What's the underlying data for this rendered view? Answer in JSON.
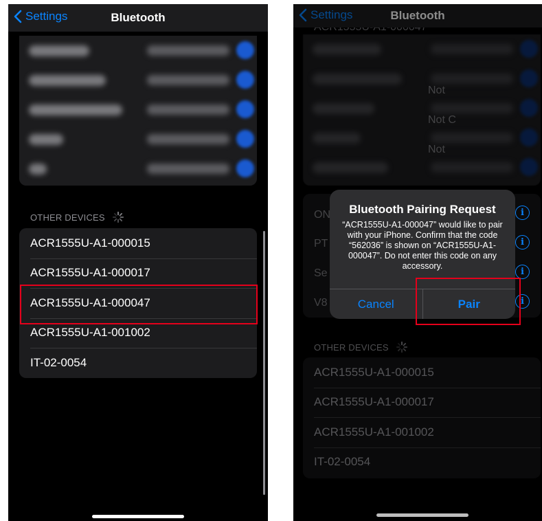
{
  "left": {
    "nav": {
      "back_label": "Settings",
      "title": "Bluetooth"
    },
    "other_devices_label": "OTHER DEVICES",
    "other_devices": [
      "ACR1555U-A1-000015",
      "ACR1555U-A1-000017",
      "ACR1555U-A1-000047",
      "ACR1555U-A1-001002",
      "IT-02-0054"
    ],
    "highlighted_device": "ACR1555U-A1-000047"
  },
  "right": {
    "nav": {
      "back_label": "Settings",
      "title": "Bluetooth"
    },
    "top_partial": "ACR1555U-A1-000047",
    "visible_status": [
      "Not",
      "Not C",
      "Not"
    ],
    "visible_letters": [
      "ON",
      "PT",
      "Se",
      "V8"
    ],
    "alert": {
      "title": "Bluetooth Pairing Request",
      "message": "“ACR1555U-A1-000047” would like to pair with your iPhone. Confirm that the code “562036” is shown on “ACR1555U-A1-000047”. Do not enter this code on any accessory.",
      "cancel_label": "Cancel",
      "pair_label": "Pair"
    },
    "other_devices_label": "OTHER DEVICES",
    "other_devices": [
      "ACR1555U-A1-000015",
      "ACR1555U-A1-000017",
      "ACR1555U-A1-001002",
      "IT-02-0054"
    ]
  },
  "colors": {
    "accent": "#0a84ff",
    "highlight": "#e5001b",
    "background": "#000000",
    "card": "#1c1c1e"
  }
}
